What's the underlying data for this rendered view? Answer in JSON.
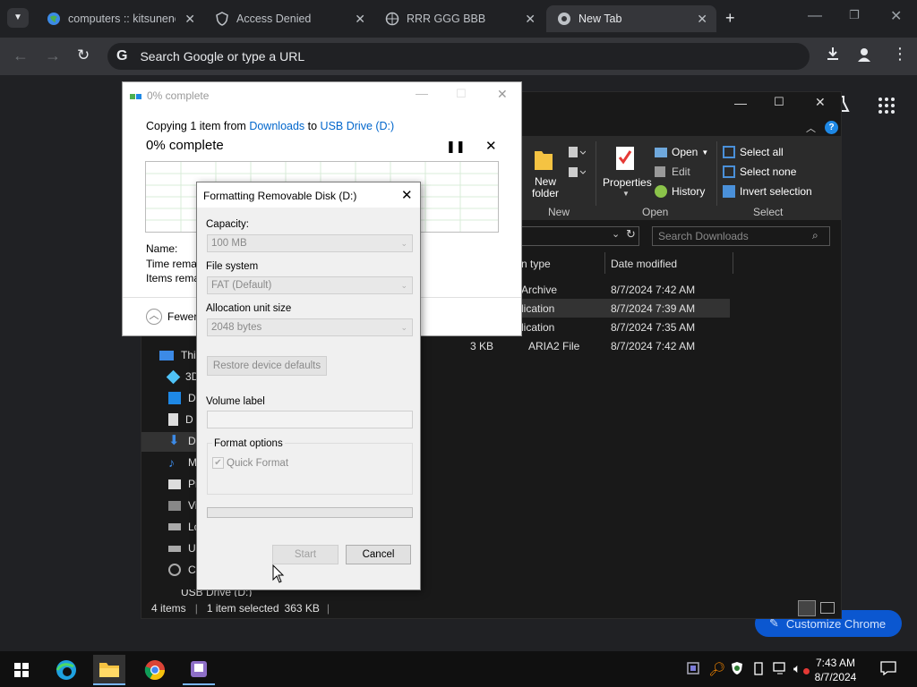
{
  "chrome": {
    "tabs": [
      {
        "title": "computers :: kitsunene",
        "active": false
      },
      {
        "title": "Access Denied",
        "active": false
      },
      {
        "title": "RRR GGG BBB",
        "active": false
      },
      {
        "title": "New Tab",
        "active": true
      }
    ],
    "omnibox_placeholder": "Search Google or type a URL",
    "customize_label": "Customize Chrome"
  },
  "explorer": {
    "ribbon": {
      "new_folder": "New\nfolder",
      "properties": "Properties",
      "open": "Open",
      "edit": "Edit",
      "history": "History",
      "select_all": "Select all",
      "select_none": "Select none",
      "invert_selection": "Invert selection",
      "groups": {
        "new": "New",
        "open": "Open",
        "select": "Select"
      }
    },
    "search_placeholder": "Search Downloads",
    "columns": {
      "type": "n type",
      "date": "Date modified"
    },
    "rows": [
      {
        "size": "",
        "type": "Archive",
        "date": "8/7/2024 7:42 AM"
      },
      {
        "size": "",
        "type": "lication",
        "date": "8/7/2024 7:39 AM"
      },
      {
        "size": "",
        "type": "lication",
        "date": "8/7/2024 7:35 AM"
      },
      {
        "size": "3 KB",
        "type": "ARIA2 File",
        "date": "8/7/2024 7:42 AM"
      }
    ],
    "nav": [
      "This",
      "3D",
      "D",
      "D",
      "D",
      "M",
      "Pi",
      "Vi",
      "Lo",
      "U",
      "C",
      "USB Drive (D:)"
    ],
    "status": {
      "items": "4 items",
      "selected": "1 item selected",
      "size": "363 KB"
    }
  },
  "copy_dialog": {
    "title": "0% complete",
    "line_prefix": "Copying 1 item from ",
    "from": "Downloads",
    "to_word": " to ",
    "to": "USB Drive (D:)",
    "progress": "0% complete",
    "progress_value": 0,
    "name_label": "Name:",
    "time_label": "Time rema",
    "items_label": "Items rema",
    "fewer": "Fewer"
  },
  "format_dialog": {
    "title": "Formatting Removable Disk (D:)",
    "capacity_label": "Capacity:",
    "capacity_value": "100 MB",
    "fs_label": "File system",
    "fs_value": "FAT (Default)",
    "alloc_label": "Allocation unit size",
    "alloc_value": "2048 bytes",
    "restore_btn": "Restore device defaults",
    "volume_label": "Volume label",
    "volume_value": "",
    "options_label": "Format options",
    "quick_format": "Quick Format",
    "quick_format_checked": true,
    "progress_value": 0,
    "start_btn": "Start",
    "cancel_btn": "Cancel"
  },
  "taskbar": {
    "time": "7:43 AM",
    "date": "8/7/2024"
  }
}
